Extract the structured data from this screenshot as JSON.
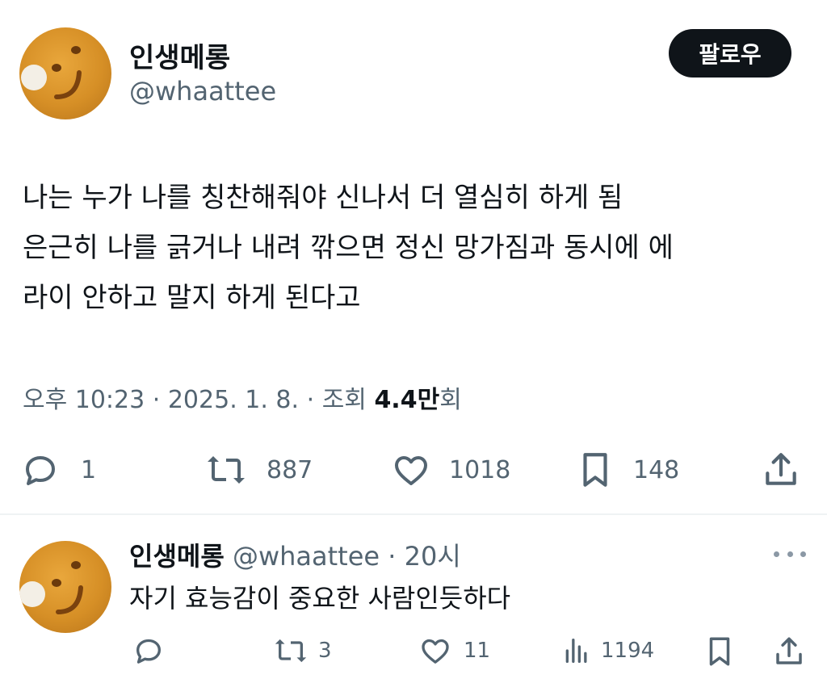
{
  "tweet": {
    "display_name": "인생메롱",
    "handle": "@whaattee",
    "follow_label": "팔로우",
    "text_lines": [
      "나는 누가 나를 칭찬해줘야 신나서 더 열심히 하게 됨",
      "은근히 나를 긁거나 내려 깎으면 정신 망가짐과 동시에 에",
      "라이 안하고 말지 하게 된다고"
    ],
    "time": "오후 10:23",
    "date": "2025. 1. 8.",
    "views_label": "조회",
    "views_number": "4.4만",
    "views_unit": "회",
    "sep": "·",
    "stats": {
      "replies": "1",
      "retweets": "887",
      "likes": "1018",
      "bookmarks": "148"
    },
    "icons": [
      "reply-icon",
      "retweet-icon",
      "like-icon",
      "bookmark-icon",
      "share-icon"
    ]
  },
  "reply": {
    "display_name": "인생메롱",
    "handle": "@whaattee",
    "sep": "·",
    "age": "20시",
    "text": "자기 효능감이 중요한 사람인듯하다",
    "stats": {
      "retweets": "3",
      "likes": "11",
      "views": "1194"
    },
    "icons": [
      "reply-icon",
      "retweet-icon",
      "like-icon",
      "analytics-icon",
      "bookmark-icon",
      "share-icon",
      "more-icon"
    ]
  },
  "colors": {
    "text": "#0f1419",
    "secondary": "#536471",
    "button_bg": "#0f1419",
    "divider": "#eff3f4",
    "avatar": "#d68f26"
  }
}
